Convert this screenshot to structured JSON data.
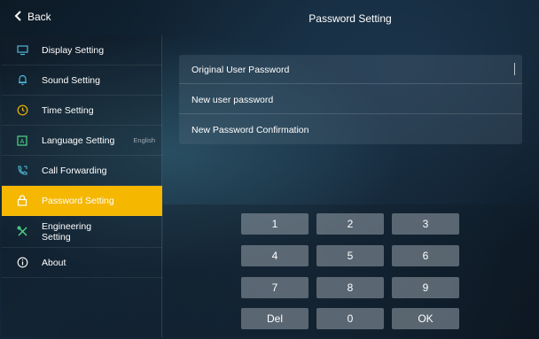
{
  "header": {
    "back_label": "Back",
    "title": "Password Setting"
  },
  "sidebar": {
    "items": [
      {
        "label": "Display Setting",
        "icon": "monitor-icon"
      },
      {
        "label": "Sound Setting",
        "icon": "bell-icon"
      },
      {
        "label": "Time Setting",
        "icon": "clock-icon"
      },
      {
        "label": "Language Setting",
        "icon": "language-icon",
        "value": "English"
      },
      {
        "label": "Call Forwarding",
        "icon": "phone-forward-icon"
      },
      {
        "label": "Password Setting",
        "icon": "lock-icon",
        "active": true
      },
      {
        "label": "Engineering Setting",
        "icon": "tools-icon"
      },
      {
        "label": "About",
        "icon": "info-icon"
      }
    ]
  },
  "form": {
    "fields": [
      {
        "label": "Original User Password"
      },
      {
        "label": "New user password"
      },
      {
        "label": "New Password Confirmation"
      }
    ]
  },
  "keypad": {
    "keys": [
      "1",
      "2",
      "3",
      "4",
      "5",
      "6",
      "7",
      "8",
      "9",
      "Del",
      "0",
      "OK"
    ]
  },
  "colors": {
    "accent": "#f5b700",
    "icon": "#4fb8d8"
  }
}
